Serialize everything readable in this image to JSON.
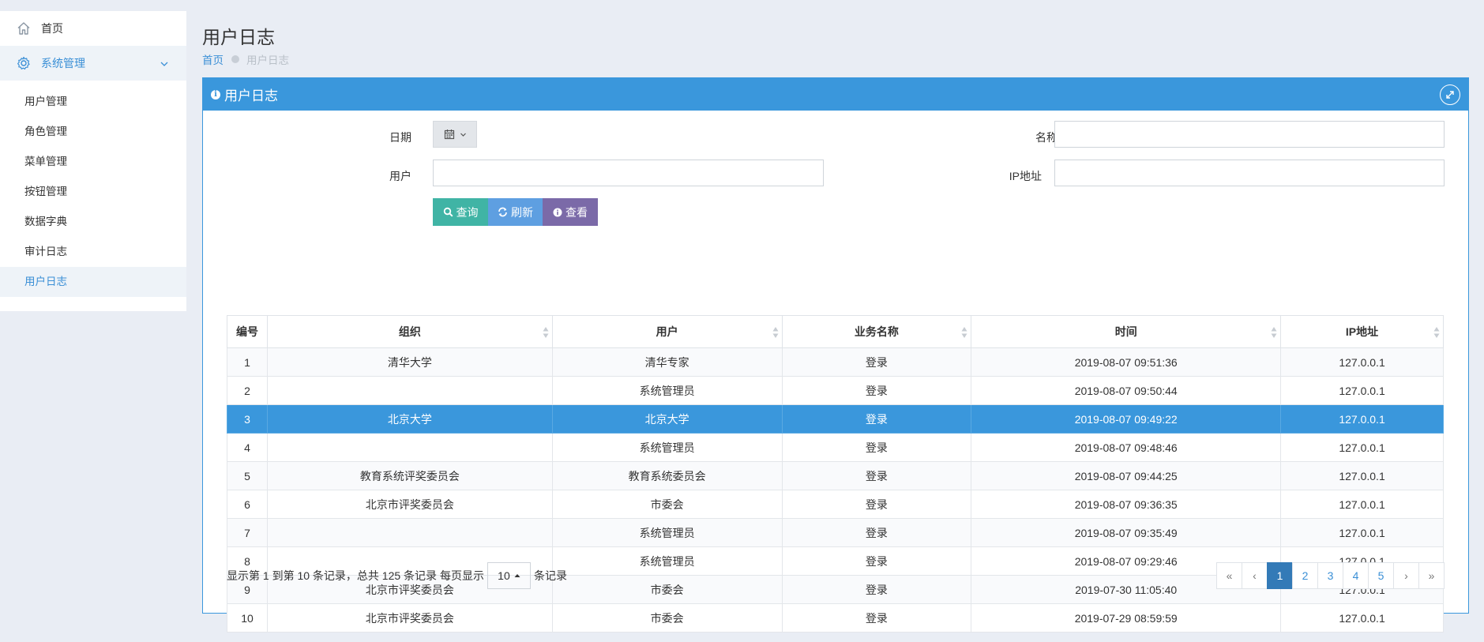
{
  "sidebar": {
    "home_label": "首页",
    "group_label": "系统管理",
    "items": [
      {
        "label": "用户管理"
      },
      {
        "label": "角色管理"
      },
      {
        "label": "菜单管理"
      },
      {
        "label": "按钮管理"
      },
      {
        "label": "数据字典"
      },
      {
        "label": "审计日志"
      },
      {
        "label": "用户日志"
      }
    ],
    "active_item": "用户日志"
  },
  "header": {
    "title": "用户日志",
    "breadcrumb": {
      "home": "首页",
      "current": "用户日志"
    }
  },
  "panel": {
    "title": "用户日志"
  },
  "filters": {
    "date_label": "日期",
    "name_label": "名称",
    "name_value": "",
    "user_label": "用户",
    "user_value": "",
    "ip_label": "IP地址",
    "ip_value": ""
  },
  "buttons": {
    "query": "查询",
    "refresh": "刷新",
    "view": "查看"
  },
  "table": {
    "columns": [
      "编号",
      "组织",
      "用户",
      "业务名称",
      "时间",
      "IP地址"
    ],
    "rows": [
      {
        "id": "1",
        "org": "清华大学",
        "user": "清华专家",
        "biz": "登录",
        "time": "2019-08-07 09:51:36",
        "ip": "127.0.0.1"
      },
      {
        "id": "2",
        "org": "",
        "user": "系统管理员",
        "biz": "登录",
        "time": "2019-08-07 09:50:44",
        "ip": "127.0.0.1"
      },
      {
        "id": "3",
        "org": "北京大学",
        "user": "北京大学",
        "biz": "登录",
        "time": "2019-08-07 09:49:22",
        "ip": "127.0.0.1"
      },
      {
        "id": "4",
        "org": "",
        "user": "系统管理员",
        "biz": "登录",
        "time": "2019-08-07 09:48:46",
        "ip": "127.0.0.1"
      },
      {
        "id": "5",
        "org": "教育系统评奖委员会",
        "user": "教育系统委员会",
        "biz": "登录",
        "time": "2019-08-07 09:44:25",
        "ip": "127.0.0.1"
      },
      {
        "id": "6",
        "org": "北京市评奖委员会",
        "user": "市委会",
        "biz": "登录",
        "time": "2019-08-07 09:36:35",
        "ip": "127.0.0.1"
      },
      {
        "id": "7",
        "org": "",
        "user": "系统管理员",
        "biz": "登录",
        "time": "2019-08-07 09:35:49",
        "ip": "127.0.0.1"
      },
      {
        "id": "8",
        "org": "",
        "user": "系统管理员",
        "biz": "登录",
        "time": "2019-08-07 09:29:46",
        "ip": "127.0.0.1"
      },
      {
        "id": "9",
        "org": "北京市评奖委员会",
        "user": "市委会",
        "biz": "登录",
        "time": "2019-07-30 11:05:40",
        "ip": "127.0.0.1"
      },
      {
        "id": "10",
        "org": "北京市评奖委员会",
        "user": "市委会",
        "biz": "登录",
        "time": "2019-07-29 08:59:59",
        "ip": "127.0.0.1"
      }
    ],
    "selected_row": "3"
  },
  "footer": {
    "summary_prefix": "显示第 1 到第 10 条记录，总共 125 条记录 每页显示",
    "page_size": "10",
    "summary_suffix": "条记录",
    "pages": [
      {
        "label": "«",
        "kind": "nav"
      },
      {
        "label": "‹",
        "kind": "nav"
      },
      {
        "label": "1",
        "kind": "page",
        "active": true
      },
      {
        "label": "2",
        "kind": "page"
      },
      {
        "label": "3",
        "kind": "page"
      },
      {
        "label": "4",
        "kind": "page"
      },
      {
        "label": "5",
        "kind": "page"
      },
      {
        "label": "›",
        "kind": "nav"
      },
      {
        "label": "»",
        "kind": "nav"
      }
    ]
  },
  "colors": {
    "primary": "#3a97dc",
    "query_btn": "#40b4a5",
    "refresh_btn": "#5e9fe1",
    "view_btn": "#7b6aa8",
    "page_active": "#337ab7",
    "background": "#e9edf4"
  },
  "icons": {
    "home": "home-icon",
    "settings": "gear-icon",
    "chevron": "chevron-down-icon",
    "info": "info-icon",
    "expand": "expand-icon",
    "calendar": "calendar-icon",
    "search": "search-icon",
    "refresh": "refresh-icon",
    "view": "info-icon",
    "sort": "sort-icon",
    "caret": "caret-up-icon"
  }
}
